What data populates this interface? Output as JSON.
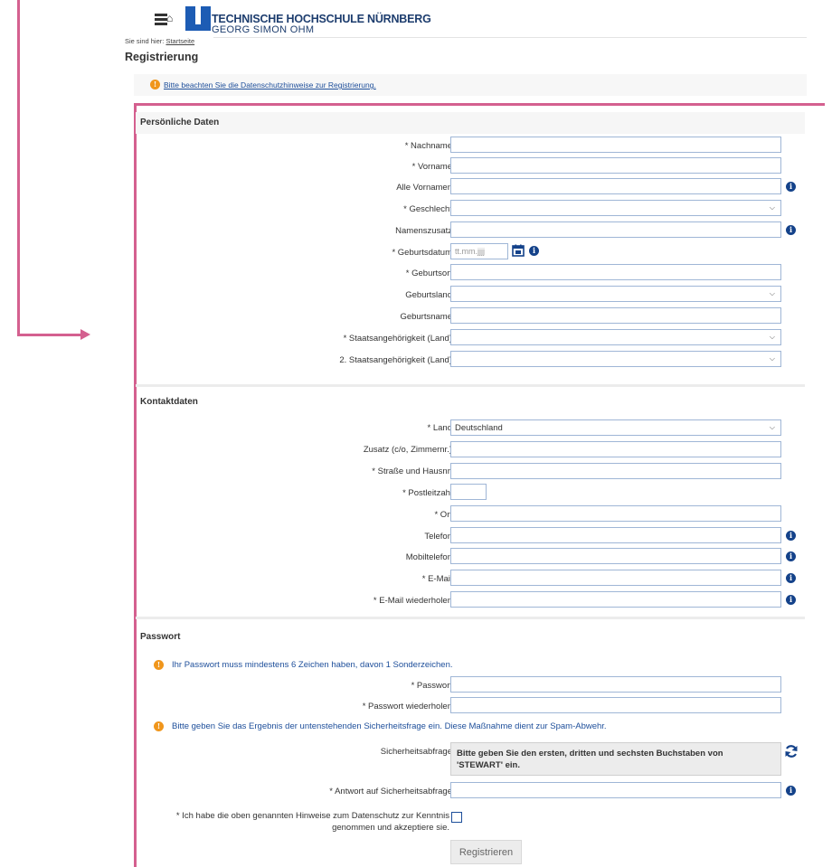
{
  "header": {
    "brand_line1": "TECHNISCHE HOCHSCHULE NÜRNBERG",
    "brand_line2": "GEORG SIMON OHM",
    "breadcrumb_prefix": "Sie sind hier:",
    "breadcrumb_link": "Startseite",
    "page_title": "Registrierung",
    "privacy_notice": "Bitte beachten Sie die Datenschutzhinweise zur Registrierung.",
    "brand_color": "#1d3d6e"
  },
  "personal": {
    "title": "Persönliche Daten",
    "fields": [
      {
        "label": "* Nachname",
        "value": ""
      },
      {
        "label": "* Vorname",
        "value": ""
      },
      {
        "label": "Alle Vornamen",
        "value": ""
      },
      {
        "label": "* Geschlecht",
        "value": ""
      },
      {
        "label": "Namenszusatz",
        "value": ""
      },
      {
        "label": "* Geburtsdatum",
        "placeholder": "tt.mm.jjjj"
      },
      {
        "label": "* Geburtsort",
        "value": ""
      },
      {
        "label": "Geburtsland",
        "value": ""
      },
      {
        "label": "Geburtsname",
        "value": ""
      },
      {
        "label": "* Staatsangehörigkeit (Land)",
        "value": ""
      },
      {
        "label": "2. Staatsangehörigkeit (Land)",
        "value": ""
      }
    ]
  },
  "contact": {
    "title": "Kontaktdaten",
    "fields": [
      {
        "label": "* Land",
        "value": "Deutschland"
      },
      {
        "label": "Zusatz (c/o, Zimmernr.)",
        "value": ""
      },
      {
        "label": "* Straße und Hausnr.",
        "value": ""
      },
      {
        "label": "* Postleitzahl",
        "value": ""
      },
      {
        "label": "* Ort",
        "value": ""
      },
      {
        "label": "Telefon",
        "value": ""
      },
      {
        "label": "Mobiltelefon",
        "value": ""
      },
      {
        "label": "* E-Mail",
        "value": ""
      },
      {
        "label": "* E-Mail wiederholen",
        "value": ""
      }
    ]
  },
  "password": {
    "title": "Passwort",
    "notice": "Ihr Passwort muss mindestens 6 Zeichen haben, davon 1 Sonderzeichen.",
    "fields": [
      {
        "label": "* Passwort",
        "value": ""
      },
      {
        "label": "* Passwort wiederholen",
        "value": ""
      }
    ],
    "captcha_notice": "Bitte geben Sie das Ergebnis der untenstehenden Sicherheitsfrage ein. Diese Maßnahme dient zur Spam-Abwehr.",
    "captcha_label": "Sicherheitsabfrage",
    "captcha_question": "Bitte geben Sie den ersten, dritten und sechsten Buchstaben von 'STEWART' ein.",
    "answer_label": "* Antwort auf Sicherheitsabfrage",
    "answer_value": "",
    "consent_text": "* Ich habe die oben genannten Hinweise zum Datenschutz zur Kenntnis genommen und akzeptiere sie.",
    "submit_label": "Registrieren"
  },
  "icons": {
    "menu": "menu-icon",
    "home": "home-icon",
    "info": "info-icon",
    "warning": "warning-icon",
    "calendar": "calendar-icon",
    "refresh": "refresh-icon",
    "chevron": "chevron-down-icon"
  },
  "colors": {
    "accent": "#14428a",
    "warning": "#f0961c",
    "annotation": "#d4608f"
  }
}
